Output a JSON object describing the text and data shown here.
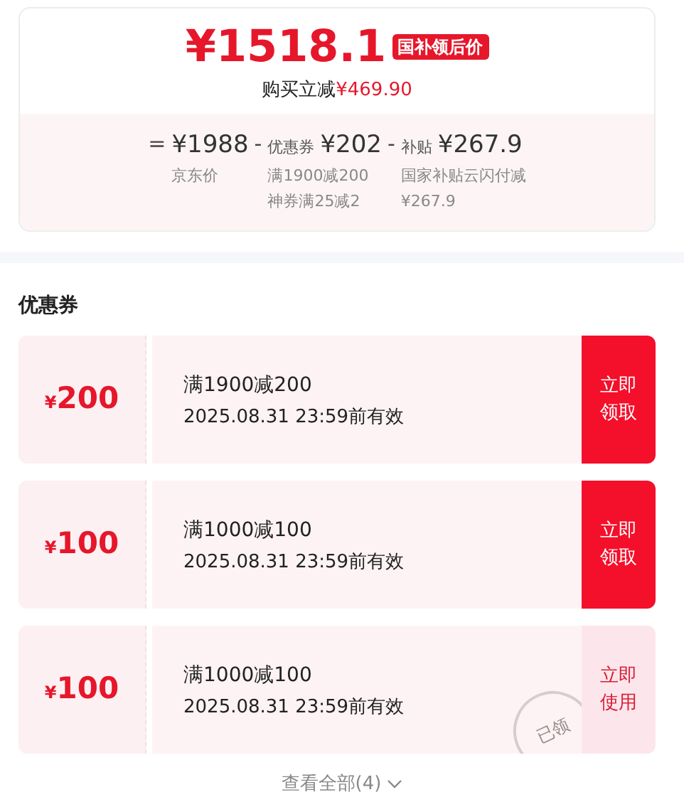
{
  "price_card": {
    "currency": "¥",
    "price": "1518.1",
    "tag": "国补领后价",
    "saving_label": "购买立减",
    "saving_value": "¥469.90",
    "breakdown": [
      {
        "operator": "=",
        "value": "¥1988",
        "notes": [
          "京东价"
        ]
      },
      {
        "operator": "-",
        "label": "优惠券",
        "value": "¥202",
        "notes": [
          "满1900减200",
          "神券满25减2"
        ]
      },
      {
        "operator": "-",
        "label": "补贴",
        "value": "¥267.9",
        "notes": [
          "国家补贴云闪付减",
          "¥267.9"
        ]
      }
    ]
  },
  "coupons_section": {
    "title": "优惠券",
    "coupons": [
      {
        "currency": "¥",
        "amount": "200",
        "condition": "满1900减200",
        "validity": "2025.08.31 23:59前有效",
        "action": "立即领取",
        "claimed": false
      },
      {
        "currency": "¥",
        "amount": "100",
        "condition": "满1000减100",
        "validity": "2025.08.31 23:59前有效",
        "action": "立即领取",
        "claimed": false
      },
      {
        "currency": "¥",
        "amount": "100",
        "condition": "满1000减100",
        "validity": "2025.08.31 23:59前有效",
        "action": "立即使用",
        "claimed": true,
        "stamp": "已领"
      }
    ],
    "view_all": "查看全部(4)"
  }
}
